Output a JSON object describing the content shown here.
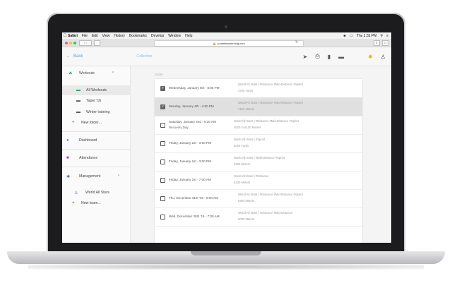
{
  "menubar": {
    "apple_icon": "apple-icon",
    "items": [
      "Safari",
      "File",
      "Edit",
      "View",
      "History",
      "Bookmarks",
      "Develop",
      "Window",
      "Help"
    ],
    "clock": "Thu 1:31 PM"
  },
  "browser": {
    "url": "commitswimming.com",
    "lock_icon": "lock-icon"
  },
  "header": {
    "back_label": "Back",
    "collection_label": "Collection",
    "tools": [
      "send-icon",
      "print-icon",
      "trash-icon",
      "folder-icon",
      "sun-icon",
      "person-icon"
    ]
  },
  "sidebar": {
    "workouts": "Workouts",
    "all_workouts": "All Workouts",
    "taper": "Taper '16",
    "winter": "Winter training",
    "new_folder": "New folder...",
    "dashboard": "Dashboard",
    "attendance": "Attendance",
    "management": "Management",
    "team": "World All Stars",
    "new_team": "New team..."
  },
  "main": {
    "sort_label": "Order",
    "rows": [
      {
        "date": "Wednesday, January 6th - 8:05 PM",
        "note": "",
        "tags": "World All Stars | #Distance #Mid-Distance #Sprint",
        "distance": "4700 Yards",
        "checked": true
      },
      {
        "date": "Monday, January 4th - 4:50 PM",
        "note": "",
        "tags": "World All Stars | #Distance #Mid-Distance #Sprint",
        "distance": "7150 Meters",
        "checked": true
      },
      {
        "date": "Saturday, January 2nd - 5:30 AM",
        "note": "Recovery Day",
        "tags": "World All Stars | #Distance #Mid-Distance #Sprint",
        "distance": "4000 to 6100 Meters",
        "checked": false
      },
      {
        "date": "Friday, January 1st - 3:00 PM",
        "note": "",
        "tags": "World All Stars | #Sprint",
        "distance": "5000 Yards",
        "checked": false
      },
      {
        "date": "Friday, January 1st - 3:00 PM",
        "note": "",
        "tags": "World All Stars | #Mid-Distance #Sprint",
        "distance": "4200 Meters",
        "checked": false
      },
      {
        "date": "Friday, January 1st - 7:00 AM",
        "note": "",
        "tags": "World All Stars | #Distance",
        "distance": "6100 Meters",
        "checked": false
      },
      {
        "date": "Thu, December 31st '15 - 9:00 AM",
        "note": "",
        "tags": "World All Stars | #Distance #Mid-Distance #Sprint",
        "distance": "6300 Meters",
        "checked": false
      },
      {
        "date": "Wed, December 30th '15 - 7:00 AM",
        "note": "",
        "tags": "World All Stars | #Distance #Mid-Distance",
        "distance": "6000 Meters",
        "checked": false
      }
    ],
    "fab_label": "+"
  },
  "colors": {
    "accent": "#4aa3d8",
    "fab": "#f05a4a",
    "team_icon": "#3b6fd6",
    "workouts_icon": "#2e9d5b"
  }
}
